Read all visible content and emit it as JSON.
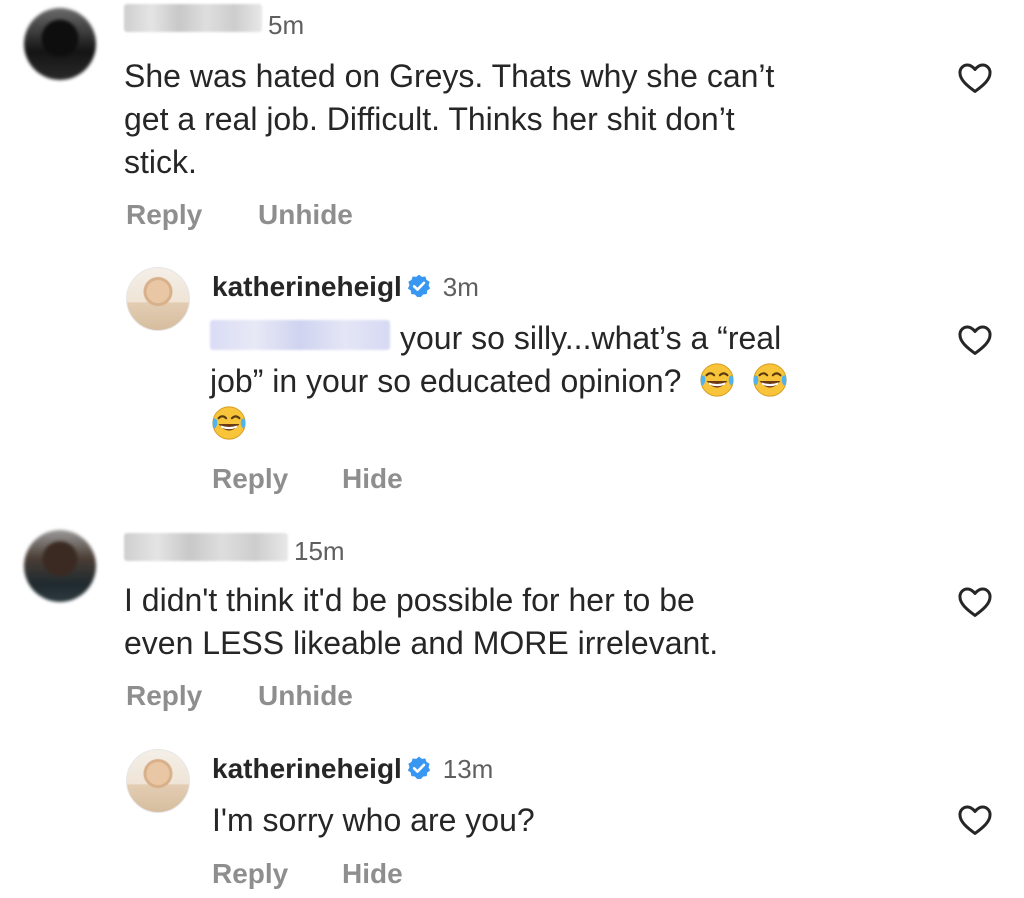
{
  "comments": [
    {
      "time": "5m",
      "text": "She was hated on Greys. Thats why she can’t get a real job. Difficult. Thinks her shit don’t stick.",
      "line1": "She was hated on Greys. Thats why she can’t",
      "line2": "get a real job. Difficult. Thinks her shit don’t",
      "line3": "stick.",
      "reply_label": "Reply",
      "hide_label": "Unhide",
      "reply": {
        "username": "katherineheigl",
        "time": "3m",
        "line1": "your so silly...what’s a “real",
        "line2": "job” in your so educated opinion?",
        "emoji_count": 3,
        "reply_label": "Reply",
        "hide_label": "Hide"
      }
    },
    {
      "time": "15m",
      "line1": "I didn't think it'd be possible for her to be",
      "line2": "even LESS likeable and MORE irrelevant.",
      "reply_label": "Reply",
      "hide_label": "Unhide",
      "reply": {
        "username": "katherineheigl",
        "time": "13m",
        "line1": "I'm sorry who are you?",
        "reply_label": "Reply",
        "hide_label": "Hide"
      }
    }
  ],
  "icons": {
    "heart": "heart-outline-icon",
    "verified": "verified-badge-icon",
    "emoji": "face-with-tears-of-joy-emoji"
  },
  "colors": {
    "text": "#262626",
    "muted": "#8e8e8e",
    "verified": "#3897f0"
  }
}
